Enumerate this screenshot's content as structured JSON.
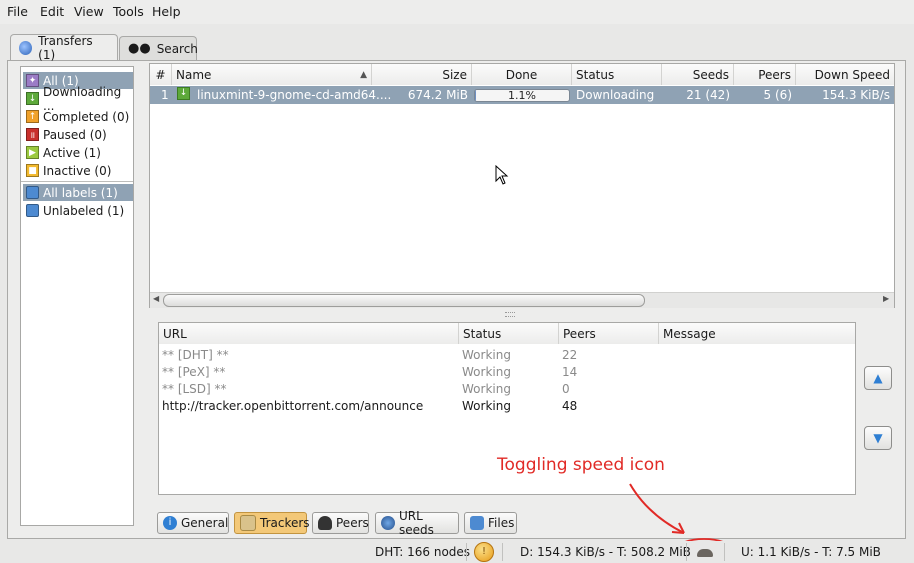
{
  "menu": [
    "File",
    "Edit",
    "View",
    "Tools",
    "Help"
  ],
  "tabs": [
    {
      "label": "Transfers (1)",
      "icon": "transfers-icon"
    },
    {
      "label": "Search",
      "icon": "binoculars-icon"
    }
  ],
  "sidebar": {
    "status_filters": [
      {
        "label": "All (1)",
        "color": "#9b7cc6",
        "selected": true
      },
      {
        "label": "Downloading ...",
        "color": "#5da93a"
      },
      {
        "label": "Completed (0)",
        "color": "#f0a12a"
      },
      {
        "label": "Paused (0)",
        "color": "#c9302c"
      },
      {
        "label": "Active (1)",
        "color": "#9bc93e"
      },
      {
        "label": "Inactive (0)",
        "color": "#f2b92e"
      }
    ],
    "label_filters": [
      {
        "label": "All labels (1)",
        "selected": true
      },
      {
        "label": "Unlabeled (1)"
      }
    ]
  },
  "torrent_list": {
    "columns": [
      "#",
      "Name",
      "Size",
      "Done",
      "Status",
      "Seeds",
      "Peers",
      "Down Speed"
    ],
    "rows": [
      {
        "num": "1",
        "name": "linuxmint-9-gnome-cd-amd64....",
        "size": "674.2 MiB",
        "done": "1.1%",
        "done_fraction": 0.011,
        "status": "Downloading",
        "seeds": "21 (42)",
        "peers": "5 (6)",
        "down_speed": "154.3 KiB/s"
      }
    ]
  },
  "trackers": {
    "columns": [
      "URL",
      "Status",
      "Peers",
      "Message"
    ],
    "rows": [
      {
        "url": "** [DHT] **",
        "status": "Working",
        "peers": "22",
        "dim": true
      },
      {
        "url": "** [PeX] **",
        "status": "Working",
        "peers": "14",
        "dim": true
      },
      {
        "url": "** [LSD] **",
        "status": "Working",
        "peers": "0",
        "dim": true
      },
      {
        "url": "http://tracker.openbittorrent.com/announce",
        "status": "Working",
        "peers": "48",
        "dim": false
      }
    ]
  },
  "detail_tabs": [
    {
      "label": "General",
      "icon": "info-icon"
    },
    {
      "label": "Trackers",
      "icon": "trackers-icon",
      "active": true
    },
    {
      "label": "Peers",
      "icon": "peers-icon"
    },
    {
      "label": "URL seeds",
      "icon": "url-seeds-icon"
    },
    {
      "label": "Files",
      "icon": "files-icon"
    }
  ],
  "statusbar": {
    "dht": "DHT: 166 nodes",
    "download": "D: 154.3 KiB/s - T: 508.2 MiB",
    "upload": "U: 1.1 KiB/s - T: 7.5 MiB"
  },
  "annotation": "Toggling speed icon"
}
